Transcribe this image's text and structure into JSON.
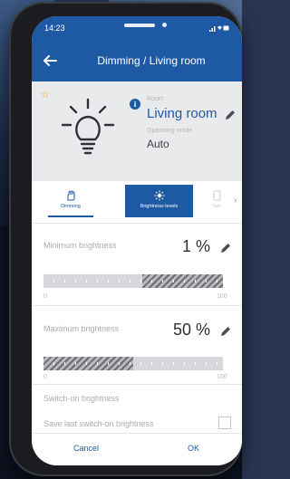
{
  "status_bar": {
    "time": "14:23"
  },
  "app_bar": {
    "title": "Dimming / Living room",
    "back_icon": "arrow-left-icon"
  },
  "device": {
    "favorite_icon": "star-icon",
    "device_icon": "light-bulb-icon",
    "info_icon": "info-icon",
    "info_glyph": "i",
    "room_label": "Room",
    "room_name": "Living room",
    "operating_mode_label": "Operating mode",
    "operating_mode_value": "Auto"
  },
  "tabs": [
    {
      "label": "Dimming",
      "icon": "hand-icon",
      "selected": false
    },
    {
      "label": "Brightness levels",
      "icon": "sun-icon",
      "selected": true
    },
    {
      "label": "Swi",
      "icon": "switch-icon",
      "selected": false
    }
  ],
  "minimum_brightness": {
    "label": "Minimum brightness",
    "value_text": "1 %",
    "level_fraction": 0.01,
    "scale_min": "0",
    "scale_max": "100"
  },
  "maximum_brightness": {
    "label": "Maximum brightness",
    "value_text": "50 %",
    "level_fraction": 0.5,
    "scale_min": "0",
    "scale_max": "100"
  },
  "switch_on": {
    "section_label": "Switch-on brightness",
    "save_last_label": "Save last switch-on brightness",
    "save_last_checked": false
  },
  "footer": {
    "cancel_label": "Cancel",
    "ok_label": "OK"
  },
  "colors": {
    "accent": "#1e5aa4",
    "favorite": "#f2a71b",
    "background": "#ffffff"
  }
}
